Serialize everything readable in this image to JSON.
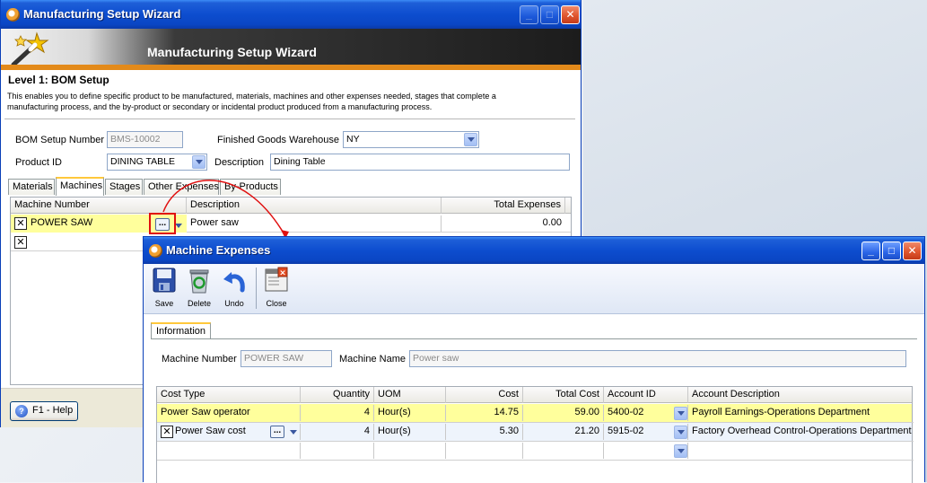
{
  "wizard": {
    "title": "Manufacturing Setup Wizard",
    "banner_title": "Manufacturing Setup Wizard",
    "level_title": "Level 1: BOM Setup",
    "description": "This enables you to define specific product to be manufactured, materials, machines and other expenses needed, stages that complete a manufacturing process, and the by-product or secondary or incidental product produced from a manufacturing process.",
    "form": {
      "bom_setup_number_label": "BOM Setup Number",
      "bom_setup_number_value": "BMS-10002",
      "finished_goods_warehouse_label": "Finished Goods Warehouse",
      "finished_goods_warehouse_value": "NY",
      "product_id_label": "Product ID",
      "product_id_value": "DINING TABLE",
      "description_label": "Description",
      "description_value": "Dining Table"
    },
    "tabs": [
      "Materials",
      "Machines",
      "Stages",
      "Other Expenses",
      "By-Products"
    ],
    "active_tab": "Machines",
    "grid": {
      "columns": [
        "Machine Number",
        "Description",
        "Total Expenses"
      ],
      "rows": [
        {
          "machine_number": "POWER SAW",
          "description": "Power saw",
          "total_expenses": "0.00"
        }
      ]
    },
    "help_label": "F1 - Help"
  },
  "expenses": {
    "title": "Machine Expenses",
    "toolbar": {
      "save": "Save",
      "delete": "Delete",
      "undo": "Undo",
      "close": "Close"
    },
    "info_tab": "Information",
    "machine_number_label": "Machine Number",
    "machine_number_value": "POWER SAW",
    "machine_name_label": "Machine Name",
    "machine_name_value": "Power saw",
    "grid": {
      "columns": [
        "Cost Type",
        "Quantity",
        "UOM",
        "Cost",
        "Total Cost",
        "Account ID",
        "Account Description"
      ],
      "rows": [
        {
          "cost_type": "Power Saw operator",
          "quantity": "4",
          "uom": "Hour(s)",
          "cost": "14.75",
          "total_cost": "59.00",
          "account_id": "5400-02",
          "account_description": "Payroll Earnings-Operations Department"
        },
        {
          "cost_type": "Power Saw cost",
          "quantity": "4",
          "uom": "Hour(s)",
          "cost": "5.30",
          "total_cost": "21.20",
          "account_id": "5915-02",
          "account_description": "Factory Overhead Control-Operations Department"
        }
      ]
    }
  },
  "colors": {
    "titlebar": "#0a46c4",
    "highlight_row": "#ffff9c",
    "callout_arrow": "#e01010",
    "banner_stripe": "#e38a1a"
  }
}
